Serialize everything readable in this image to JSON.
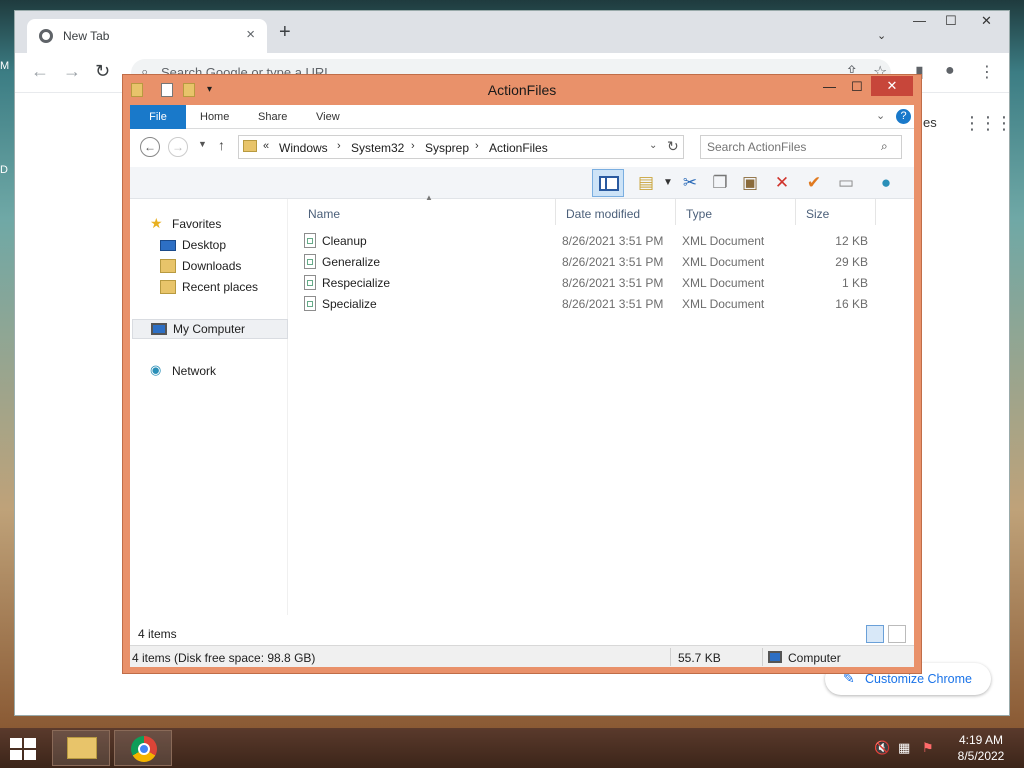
{
  "desktop": {
    "edge_marks": [
      "M",
      "D"
    ]
  },
  "chrome": {
    "tab_title": "New Tab",
    "tab_close": "×",
    "new_tab": "+",
    "omnibox_placeholder": "Search Google or type a URL",
    "partial_text": "es",
    "customize_label": "Customize Chrome",
    "window_min": "—",
    "window_max": "☐",
    "window_close": "✕"
  },
  "explorer": {
    "title": "ActionFiles",
    "ribbon_tabs": [
      "File",
      "Home",
      "Share",
      "View"
    ],
    "help": "?",
    "address": {
      "overflow": "«",
      "crumbs": [
        "Windows",
        "System32",
        "Sysprep",
        "ActionFiles"
      ],
      "separator": "›"
    },
    "search_placeholder": "Search ActionFiles",
    "nav": {
      "favorites": "Favorites",
      "desktop": "Desktop",
      "downloads": "Downloads",
      "recent": "Recent places",
      "computer": "My Computer",
      "network": "Network"
    },
    "columns": {
      "name": "Name",
      "date": "Date modified",
      "type": "Type",
      "size": "Size"
    },
    "files": [
      {
        "name": "Cleanup",
        "date": "8/26/2021 3:51 PM",
        "type": "XML Document",
        "size": "12 KB"
      },
      {
        "name": "Generalize",
        "date": "8/26/2021 3:51 PM",
        "type": "XML Document",
        "size": "29 KB"
      },
      {
        "name": "Respecialize",
        "date": "8/26/2021 3:51 PM",
        "type": "XML Document",
        "size": "1 KB"
      },
      {
        "name": "Specialize",
        "date": "8/26/2021 3:51 PM",
        "type": "XML Document",
        "size": "16 KB"
      }
    ],
    "item_count": "4 items",
    "status": {
      "left": "4 items (Disk free space: 98.8 GB)",
      "size": "55.7 KB",
      "location": "Computer"
    }
  },
  "taskbar": {
    "time": "4:19 AM",
    "date": "8/5/2022"
  }
}
